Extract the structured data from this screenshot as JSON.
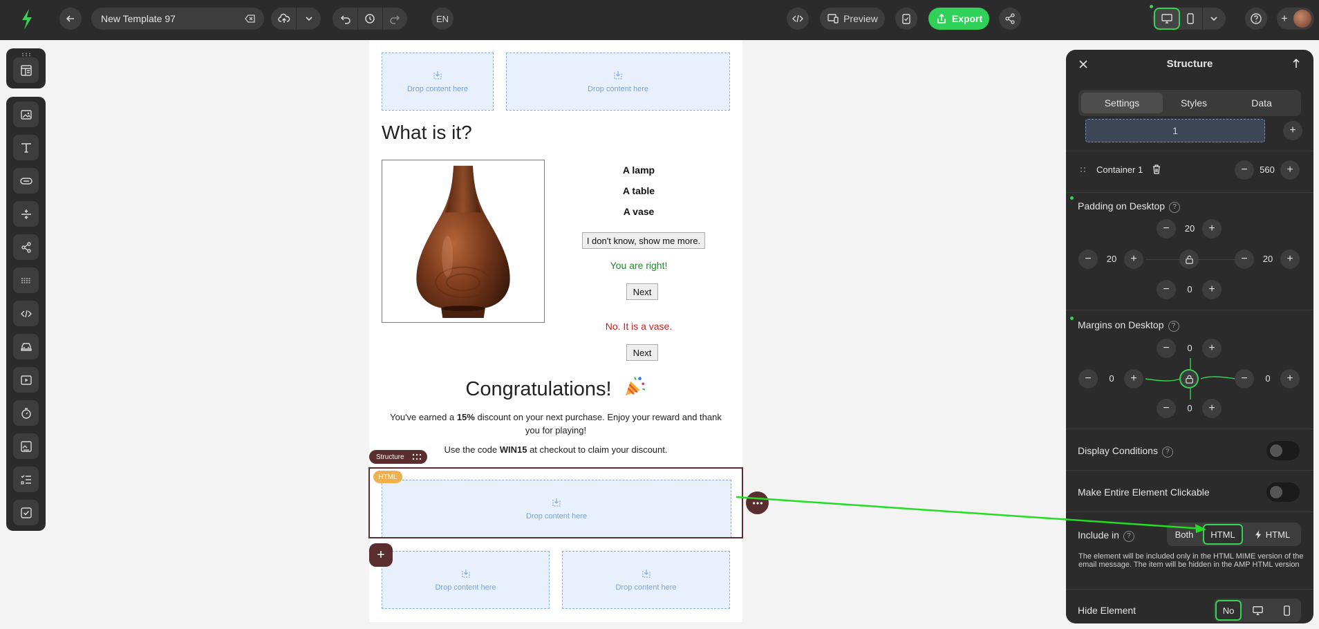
{
  "topbar": {
    "template_name": "New Template 97",
    "language": "EN",
    "preview_label": "Preview",
    "export_label": "Export"
  },
  "canvas": {
    "drop_label": "Drop content here",
    "heading": "What is it?",
    "options": [
      "A lamp",
      "A table",
      "A vase"
    ],
    "show_more_label": "I don't know, show me more.",
    "right_message": "You are right!",
    "wrong_message": "No. It is a vase.",
    "next_label": "Next",
    "congrats_title": "Congratulations!",
    "reward_pre": "You've earned a ",
    "reward_bold": "15%",
    "reward_post": " discount on your next purchase. Enjoy your reward and thank you for playing!",
    "code_pre": "Use the code ",
    "code_bold": "WIN15",
    "code_post": " at checkout to claim your discount.",
    "structure_tag": "Structure",
    "html_pill": "HTML",
    "add_symbol": "+"
  },
  "panel": {
    "title": "Structure",
    "tabs": [
      "Settings",
      "Styles",
      "Data"
    ],
    "column_value": "1",
    "container_label": "Container 1",
    "container_width": "560",
    "padding_label": "Padding on Desktop",
    "padding": {
      "top": "20",
      "left": "20",
      "right": "20",
      "bottom": "0"
    },
    "margins_label": "Margins on Desktop",
    "margins": {
      "top": "0",
      "left": "0",
      "right": "0",
      "bottom": "0"
    },
    "display_conditions_label": "Display Conditions",
    "clickable_label": "Make Entire Element Clickable",
    "include_label": "Include in",
    "include_options": [
      "Both",
      "HTML",
      "HTML"
    ],
    "include_description": "The element will be included only in the HTML MIME version of the email message. The item will be hidden in the AMP HTML version",
    "hide_label": "Hide Element",
    "hide_no_label": "No",
    "help_symbol": "?",
    "minus_symbol": "−",
    "plus_symbol": "+"
  },
  "colors": {
    "accent_green": "#2fd159",
    "selection_brown": "#5a2e2e",
    "html_pill": "#f1b04b",
    "right_text": "#1f8a2b",
    "wrong_text": "#d11a1a"
  }
}
